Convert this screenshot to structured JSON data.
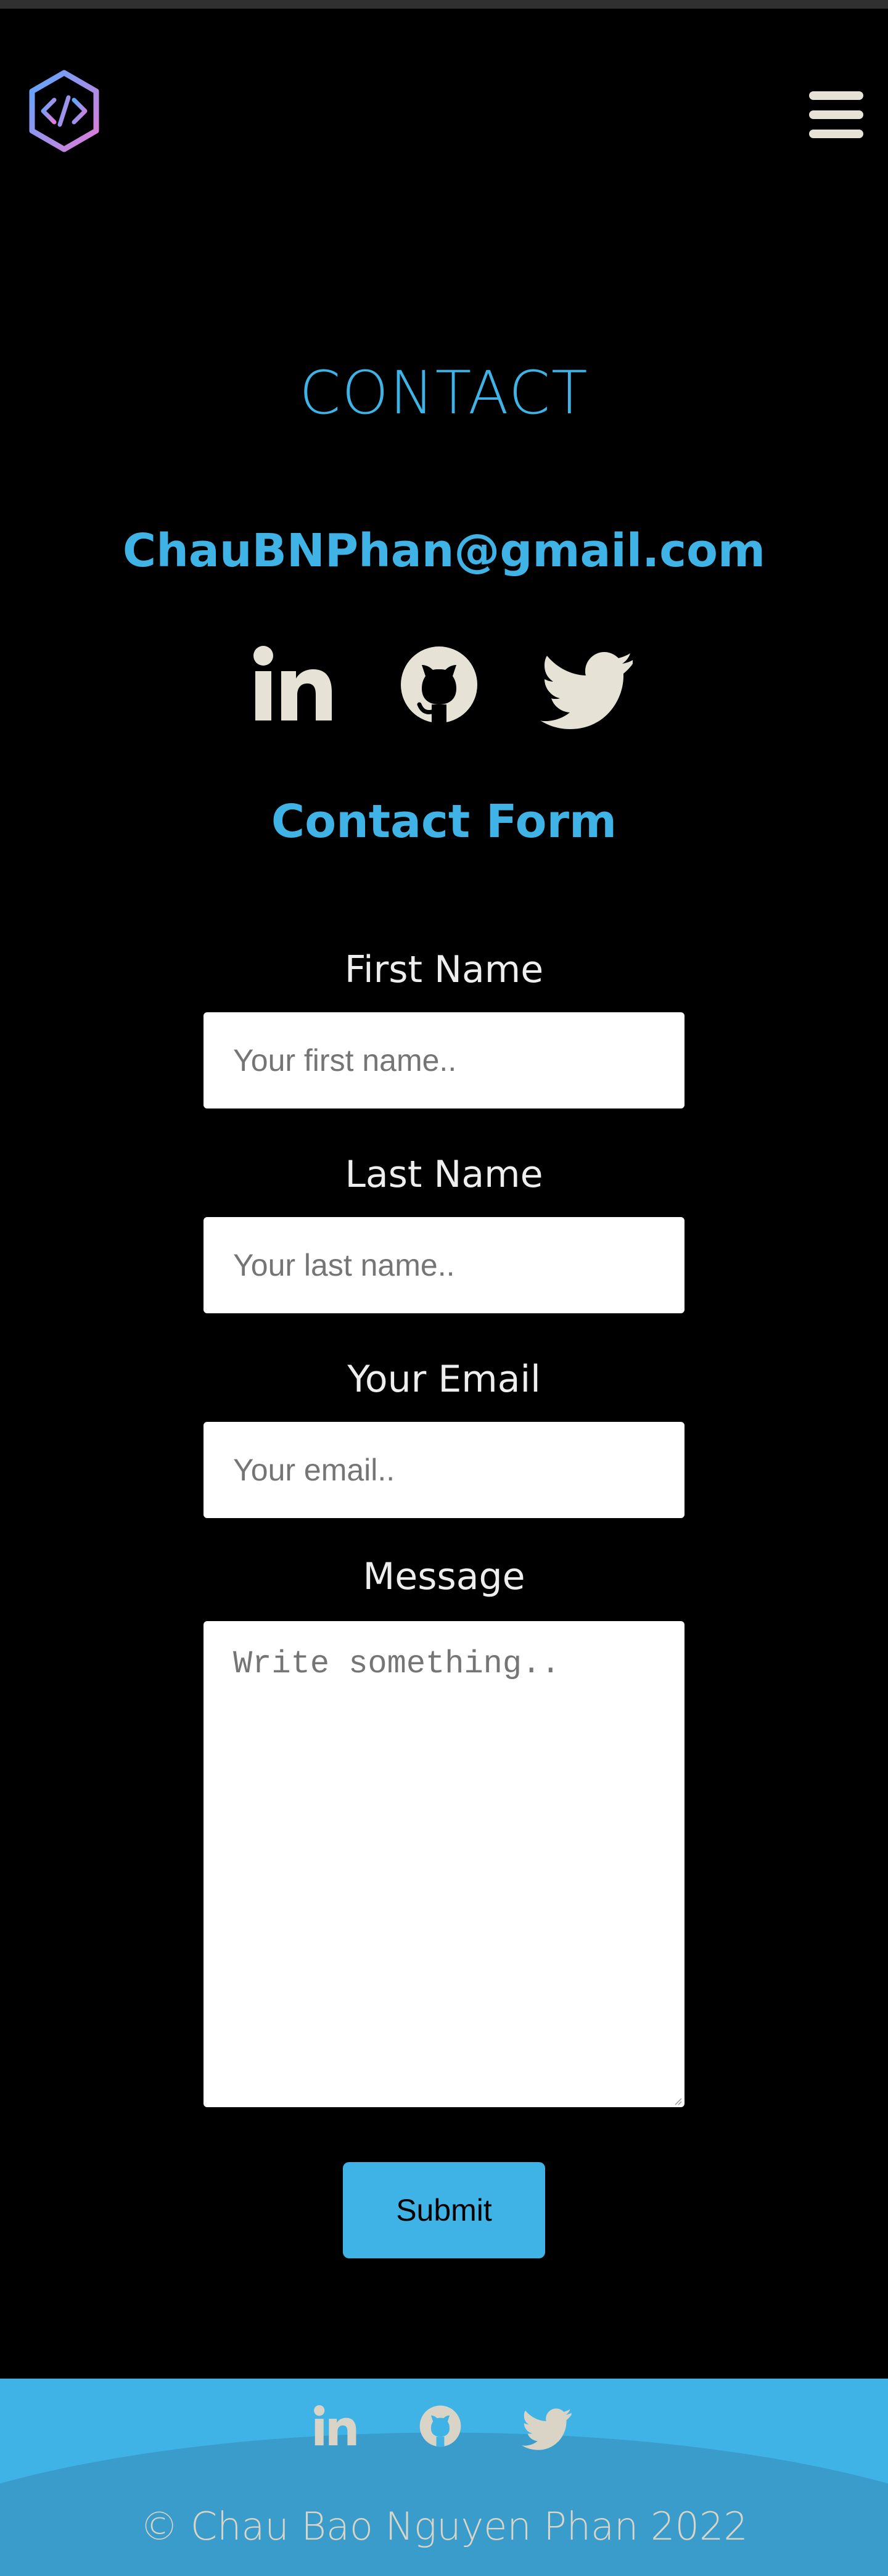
{
  "header": {
    "logo_icon": "code-hexagon-logo-icon",
    "menu_icon": "hamburger-menu-icon"
  },
  "contact": {
    "title": "CONTACT",
    "email": "ChauBNPhan@gmail.com",
    "social": [
      {
        "name": "LinkedIn",
        "icon": "linkedin-icon"
      },
      {
        "name": "GitHub",
        "icon": "github-icon"
      },
      {
        "name": "Twitter",
        "icon": "twitter-icon"
      }
    ]
  },
  "form": {
    "title": "Contact Form",
    "first_name": {
      "label": "First Name",
      "placeholder": "Your first name..",
      "value": ""
    },
    "last_name": {
      "label": "Last Name",
      "placeholder": "Your last name..",
      "value": ""
    },
    "email": {
      "label": "Your Email",
      "placeholder": "Your email..",
      "value": ""
    },
    "message": {
      "label": "Message",
      "placeholder": "Write something..",
      "value": ""
    },
    "submit_label": "Submit"
  },
  "footer": {
    "copyright": "© Chau Bao Nguyen Phan 2022"
  },
  "colors": {
    "background": "#000000",
    "accent": "#3fb3e6",
    "icon": "#e6e3d6",
    "footer_wave": "#3a9ccb",
    "copyright_text": "#d9d4c6"
  }
}
